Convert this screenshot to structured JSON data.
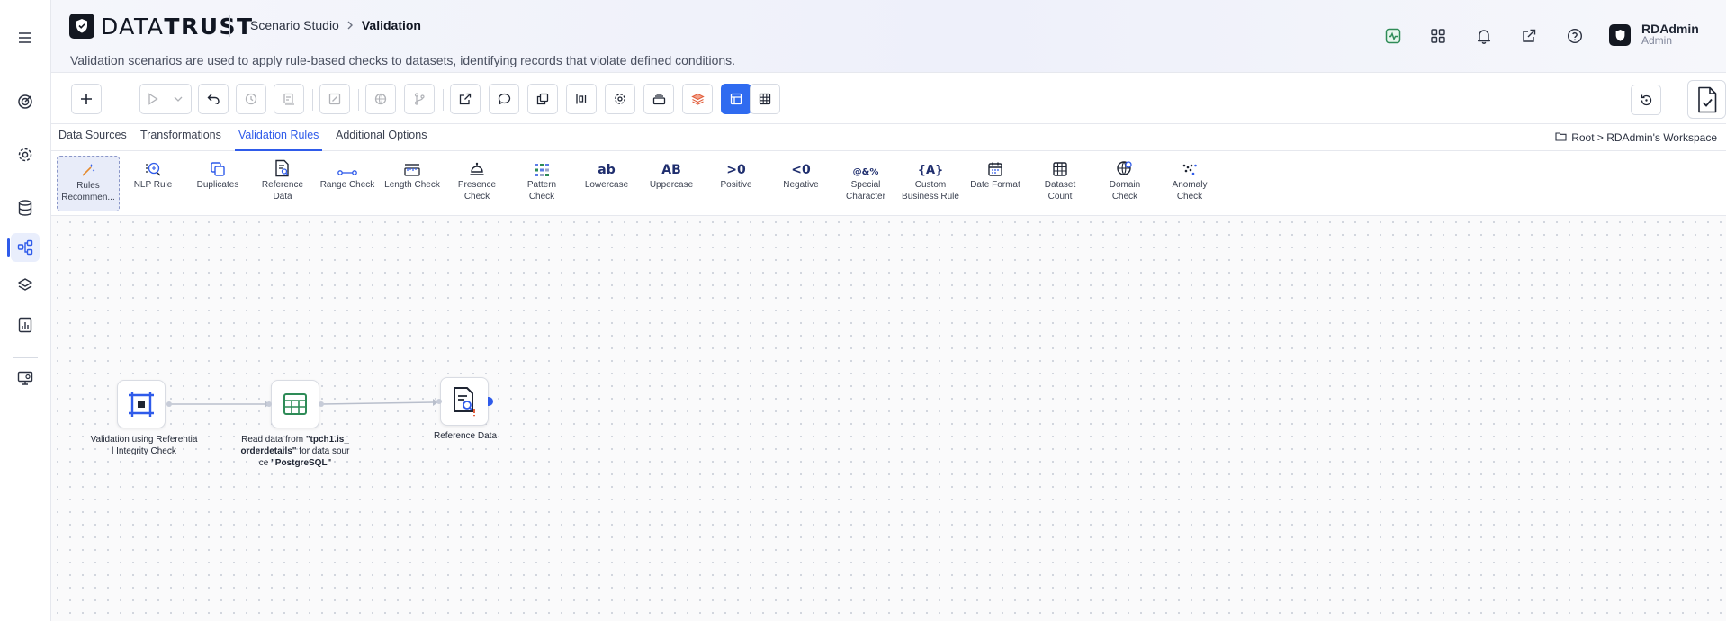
{
  "app": {
    "brand": "DATATRUST",
    "breadcrumb": {
      "parent": "Scenario Studio",
      "current": "Validation"
    },
    "description": "Validation scenarios are used to apply rule-based checks to datasets, identifying records that violate defined conditions.",
    "user": {
      "name": "RDAdmin",
      "role": "Admin"
    }
  },
  "rail": {
    "items": [
      {
        "icon": "menu-icon"
      },
      {
        "icon": "target-icon"
      },
      {
        "icon": "settings-icon"
      },
      {
        "icon": "database-icon"
      },
      {
        "icon": "workflow-icon",
        "active": true
      },
      {
        "icon": "layers-icon"
      },
      {
        "icon": "report-icon"
      },
      {
        "icon": "monitor-icon"
      }
    ]
  },
  "header_icons": [
    "activity-icon",
    "apps-grid-icon",
    "bell-icon",
    "external-link-icon",
    "help-icon"
  ],
  "tabs": {
    "items": [
      "Data Sources",
      "Transformations",
      "Validation Rules",
      "Additional Options"
    ],
    "active": "Validation Rules"
  },
  "path": {
    "text": "Root > RDAdmin's Workspace"
  },
  "palette": {
    "items": [
      {
        "label1": "Rules",
        "label2": "Recommen...",
        "icon": "magic-wand-icon",
        "selected": true
      },
      {
        "label1": "NLP Rule",
        "label2": "",
        "icon": "nlp-icon"
      },
      {
        "label1": "Duplicates",
        "label2": "",
        "icon": "duplicates-icon"
      },
      {
        "label1": "Reference",
        "label2": "Data",
        "icon": "reference-data-icon"
      },
      {
        "label1": "Range Check",
        "label2": "",
        "icon": "range-icon"
      },
      {
        "label1": "Length Check",
        "label2": "",
        "icon": "ruler-icon"
      },
      {
        "label1": "Presence",
        "label2": "Check",
        "icon": "presence-icon"
      },
      {
        "label1": "Pattern",
        "label2": "Check",
        "icon": "pattern-icon"
      },
      {
        "label1": "Lowercase",
        "label2": "",
        "glyph": "ab"
      },
      {
        "label1": "Uppercase",
        "label2": "",
        "glyph": "AB"
      },
      {
        "label1": "Positive",
        "label2": "",
        "glyph": ">0"
      },
      {
        "label1": "Negative",
        "label2": "",
        "glyph": "<0"
      },
      {
        "label1": "Special",
        "label2": "Character",
        "glyph": "@&%"
      },
      {
        "label1": "Custom",
        "label2": "Business Rule",
        "glyph": "{A}"
      },
      {
        "label1": "Date Format",
        "label2": "",
        "icon": "calendar-icon"
      },
      {
        "label1": "Dataset",
        "label2": "Count",
        "icon": "table-grid-icon"
      },
      {
        "label1": "Domain",
        "label2": "Check",
        "icon": "globe-search-icon"
      },
      {
        "label1": "Anomaly",
        "label2": "Check",
        "icon": "scatter-icon"
      }
    ]
  },
  "nodes": {
    "n1": {
      "line1": "Validation using Referentia",
      "line2": "l Integrity Check"
    },
    "n2": {
      "pre": "Read data from ",
      "q1": "\"tpch1.is_",
      "q2": "orderdetails\"",
      "mid": " for data sour",
      "line3pre": "ce ",
      "q3": "\"PostgreSQL\""
    },
    "n3": {
      "label": "Reference Data"
    }
  },
  "colors": {
    "accent": "#2f5bea",
    "brand_dark": "#141821",
    "node_blue": "#2f5bea",
    "node_green": "#2e8b57"
  }
}
